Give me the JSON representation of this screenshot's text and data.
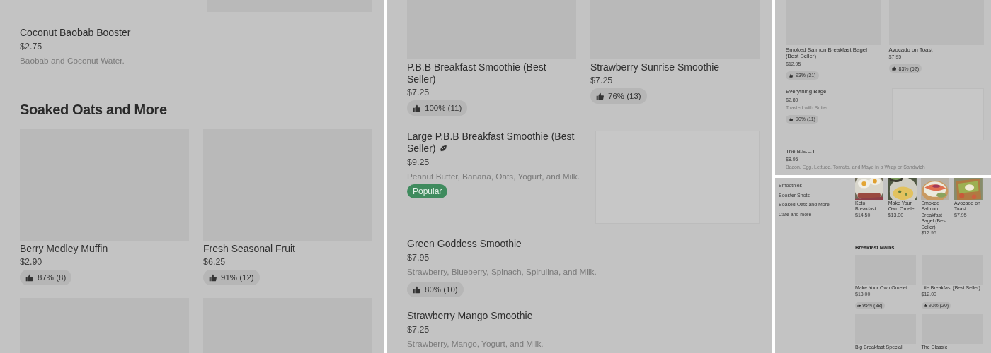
{
  "panel_1": {
    "items": [
      {
        "kind": "image-tail"
      },
      {
        "kind": "dish-row",
        "name": "Coconut Baobab Booster",
        "price": "$2.75",
        "description": "Baobab and Coconut Water.",
        "leaf_icon": false,
        "image": false
      },
      {
        "kind": "heading",
        "title": "Soaked Oats and More"
      },
      {
        "kind": "dish-grid",
        "cards": [
          {
            "kind": "dish",
            "name": "Berry Medley Muffin",
            "price": "$2.90",
            "rating": "87% (8)"
          },
          {
            "kind": "dish",
            "name": "Fresh Seasonal Fruit",
            "price": "$6.25",
            "rating": "91% (12)"
          }
        ]
      },
      {
        "kind": "dish-grid",
        "cards": [
          {
            "kind": "placeholder"
          },
          {
            "kind": "placeholder"
          }
        ]
      }
    ]
  },
  "panel_2": {
    "items": [
      {
        "kind": "dish-grid",
        "cards": [
          {
            "kind": "dish",
            "name": "P.B.B Breakfast Smoothie (Best Seller)",
            "price": "$7.25",
            "rating": "100% (11)"
          },
          {
            "kind": "dish",
            "name": "Strawberry Sunrise Smoothie",
            "price": "$7.25",
            "rating": "76% (13)"
          }
        ]
      },
      {
        "kind": "dish-row",
        "name": "Large P.B.B Breakfast Smoothie (Best Seller)",
        "price": "$9.25",
        "description": "Peanut Butter, Banana, Oats, Yogurt, and Milk.",
        "tag": "Popular",
        "leaf_icon": true,
        "image": true
      },
      {
        "kind": "dish-row",
        "name": "Green Goddess Smoothie",
        "price": "$7.95",
        "description": "Strawberry, Blueberry, Spinach, Spirulina, and Milk.",
        "rating": "80% (10)",
        "leaf_icon": false,
        "image": false
      },
      {
        "kind": "dish-row",
        "name": "Strawberry Mango Smoothie",
        "price": "$7.25",
        "description": "Strawberry, Mango, Yogurt, and Milk.",
        "leaf_icon": false,
        "image": false
      }
    ]
  },
  "panel_3": {
    "items": [
      {
        "kind": "dish-grid",
        "cards": [
          {
            "kind": "dish",
            "name": "Smoked Salmon Breakfast Bagel (Best Seller)",
            "price": "$12.95",
            "rating": "93% (31)"
          },
          {
            "kind": "dish",
            "name": "Avocado on Toast",
            "price": "$7.95",
            "rating": "83% (62)"
          }
        ]
      },
      {
        "kind": "dish-row",
        "name": "Everything Bagel",
        "price": "$2.80",
        "description": "Toasted with Butter",
        "rating": "90% (11)",
        "leaf_icon": false,
        "image": true
      },
      {
        "kind": "dish-row",
        "name": "The B.E.L.T",
        "price": "$8.95",
        "description": "Bacon, Egg, Lettuce, Tomato, and Mayo in a Wrap or Sandwich",
        "leaf_icon": false,
        "image": false
      }
    ]
  },
  "panel_4": {
    "categories": [
      "Smoothies",
      "Booster Shots",
      "Soaked Oats and More",
      "Cafe and more"
    ],
    "items": [
      {
        "kind": "carousel",
        "cards": [
          {
            "name": "Keto Breakfast",
            "price": "$14.50"
          },
          {
            "name": "Make Your Own Omelet",
            "price": "$13.00"
          },
          {
            "name": "Smoked Salmon Breakfast Bagel (Best Seller)",
            "price": "$12.95"
          },
          {
            "name": "Avocado on Toast",
            "price": "$7.95"
          }
        ]
      },
      {
        "kind": "heading",
        "title": "Breakfast Mains"
      },
      {
        "kind": "dish-grid",
        "cards": [
          {
            "kind": "dish",
            "name": "Make Your Own Omelet",
            "price": "$13.00",
            "rating": "95% (88)"
          },
          {
            "kind": "dish",
            "name": "Lite Breakfast (Best Seller)",
            "price": "$12.00",
            "rating": "90% (20)"
          }
        ]
      },
      {
        "kind": "dish-grid",
        "cards": [
          {
            "kind": "dish",
            "name": "Big Breakfast Special"
          },
          {
            "kind": "dish",
            "name": "The Classic"
          }
        ]
      }
    ]
  }
}
